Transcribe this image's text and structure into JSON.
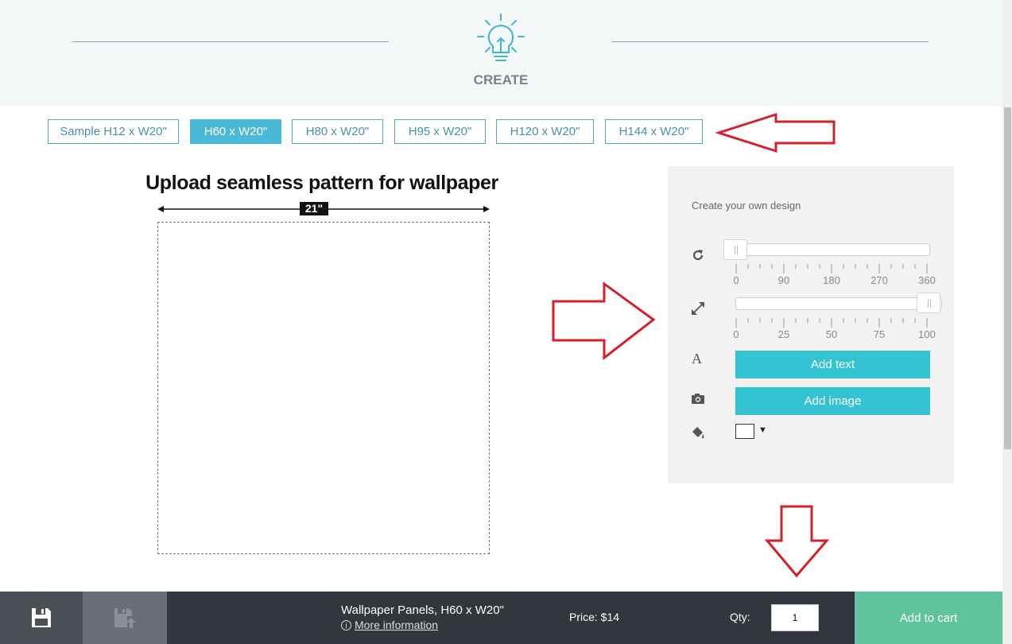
{
  "header": {
    "step_label": "CREATE",
    "step_icon": "lightbulb-icon",
    "accent_color": "#3ab8cc"
  },
  "size_tabs": [
    {
      "label": "Sample H12 x W20\"",
      "active": false
    },
    {
      "label": "H60 x W20\"",
      "active": true
    },
    {
      "label": "H80 x W20\"",
      "active": false
    },
    {
      "label": "H95 x W20\"",
      "active": false
    },
    {
      "label": "H120 x W20\"",
      "active": false
    },
    {
      "label": "H144 x W20\"",
      "active": false
    }
  ],
  "canvas": {
    "title": "Upload seamless pattern for wallpaper",
    "width_label": "21\""
  },
  "design_panel": {
    "title": "Create your own design",
    "rotate": {
      "icon": "rotate-icon",
      "value": 0,
      "ticks": [
        "0",
        "90",
        "180",
        "270",
        "360"
      ]
    },
    "scale": {
      "icon": "resize-icon",
      "value": 100,
      "ticks": [
        "0",
        "25",
        "50",
        "75",
        "100"
      ]
    },
    "add_text": {
      "icon": "text-icon",
      "label": "Add text"
    },
    "add_image": {
      "icon": "camera-icon",
      "label": "Add image"
    },
    "fill": {
      "icon": "paint-bucket-icon",
      "color": "#ffffff"
    },
    "button_color": "#33c3d3"
  },
  "footer": {
    "save_icon": "save-icon",
    "save_as_icon": "save-as-icon",
    "product_name": "Wallpaper Panels, H60 x W20\"",
    "more_info_label": "More information",
    "price_label": "Price: $14",
    "qty_label": "Qty:",
    "qty_value": "1",
    "cart_label": "Add to cart",
    "cart_color": "#5fc39e"
  },
  "annotation_arrows": {
    "color": "#d4202a"
  }
}
